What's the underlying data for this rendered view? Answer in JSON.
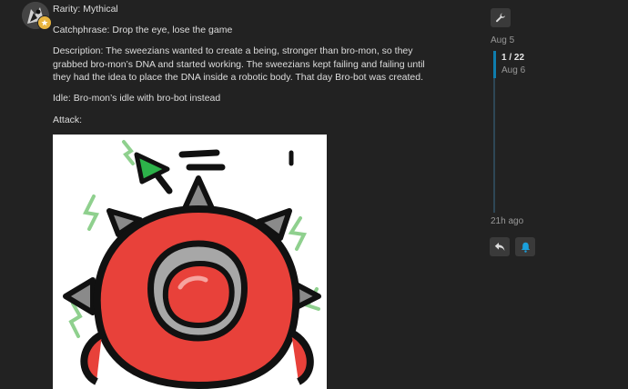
{
  "post": {
    "rarity": "Rarity: Mythical",
    "catchphrase": "Catchphrase: Drop the eye, lose the game",
    "description": "Description: The sweezians wanted to create a being, stronger than bro-mon, so they grabbed bro-mon’s DNA and started working. The sweezians kept failing and failing until they had the idea to place the DNA inside a robotic body. That day Bro-bot was created.",
    "idle": "Idle: Bro-mon’s idle with bro-bot instead",
    "attack": "Attack:"
  },
  "timeline": {
    "start_date": "Aug 5",
    "progress": "1 / 22",
    "progress_date": "Aug 6",
    "last_activity": "21h ago"
  },
  "icons": {
    "wrench": "wrench-icon",
    "reply": "reply-icon",
    "notify": "bell-icon",
    "avatar_badge": "badge-icon"
  },
  "colors": {
    "accent": "#0f7dad",
    "robot_red": "#e8413a",
    "lightning": "#8fd08e",
    "arrow": "#2db24a"
  }
}
